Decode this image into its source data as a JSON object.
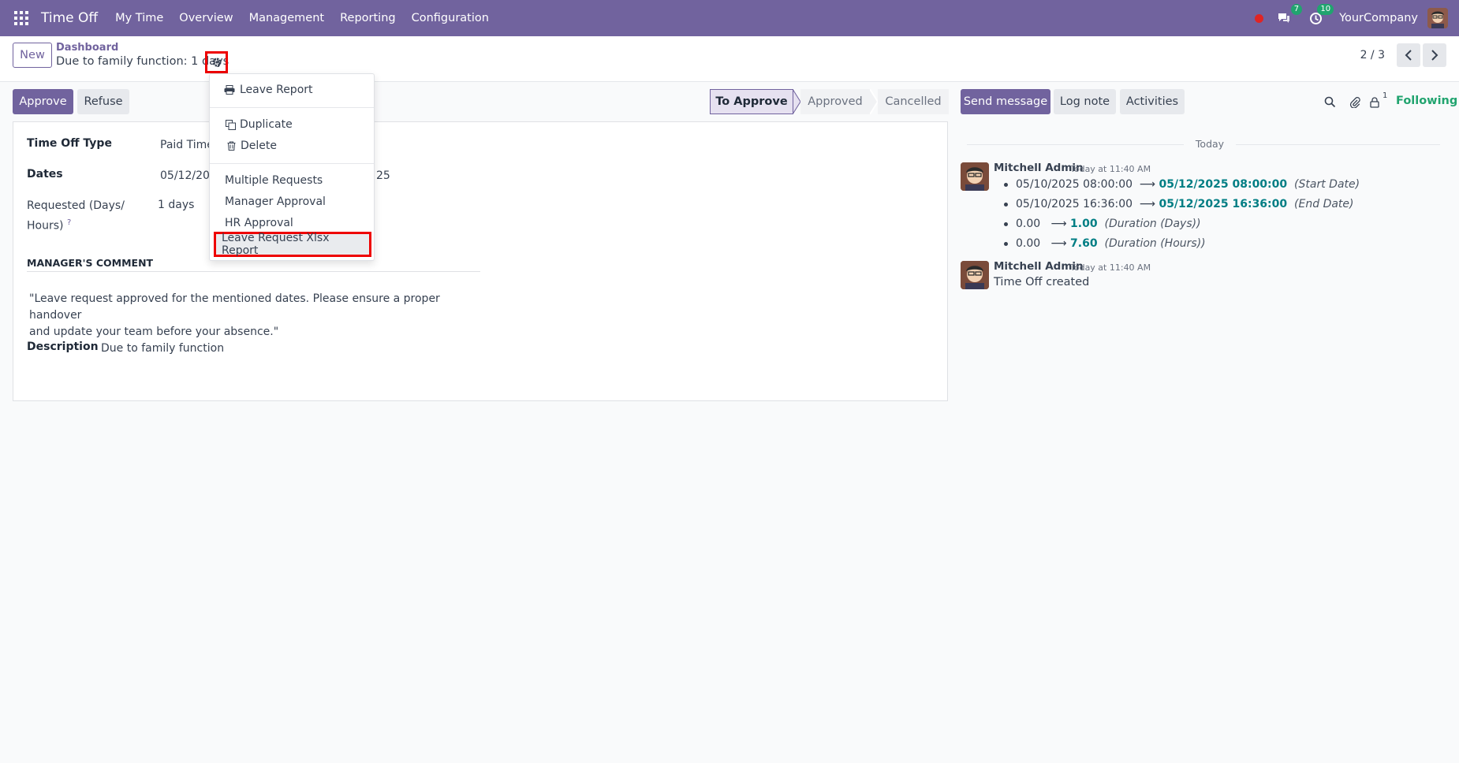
{
  "navbar": {
    "app_name": "Time Off",
    "menu": [
      "My Time",
      "Overview",
      "Management",
      "Reporting",
      "Configuration"
    ],
    "messages_badge": "7",
    "activities_badge": "10",
    "company": "YourCompany"
  },
  "control_panel": {
    "new_label": "New",
    "breadcrumb": "Dashboard",
    "record_title": "Due to family function: 1 days",
    "pager": "2 / 3"
  },
  "actions": {
    "approve": "Approve",
    "refuse": "Refuse"
  },
  "statusbar": [
    "To Approve",
    "Approved",
    "Cancelled"
  ],
  "form": {
    "time_off_type_label": "Time Off Type",
    "time_off_type_value": "Paid Time",
    "dates_label": "Dates",
    "dates_value_start": "05/12/20",
    "dates_value_end": "25",
    "requested_label_line1": "Requested (Days/",
    "requested_label_line2": "Hours)",
    "help_mark": "?",
    "requested_value": "1 days",
    "manager_comment_title": "MANAGER'S COMMENT",
    "manager_comment_line1": "\"Leave request approved for the mentioned dates. Please ensure a proper handover",
    "manager_comment_line2": "and update your team before your absence.\"",
    "description_label": "Description",
    "description_value": "Due to family function"
  },
  "action_menu": {
    "items": [
      "Leave Report",
      "Duplicate",
      "Delete",
      "Multiple Requests",
      "Manager Approval",
      "HR Approval",
      "Leave Request Xlsx Report"
    ]
  },
  "chatter": {
    "send_message": "Send message",
    "log_note": "Log note",
    "activities": "Activities",
    "follower_count": "1",
    "following": "Following",
    "day_label": "Today",
    "messages": [
      {
        "author": "Mitchell Admin",
        "date": "Today at 11:40 AM",
        "tracking": [
          {
            "old": "05/10/2025 08:00:00",
            "new": "05/12/2025 08:00:00",
            "field": "(Start Date)"
          },
          {
            "old": "05/10/2025 16:36:00",
            "new": "05/12/2025 16:36:00",
            "field": "(End Date)"
          },
          {
            "old": "0.00",
            "new": "1.00",
            "field": "(Duration (Days))"
          },
          {
            "old": "0.00",
            "new": "7.60",
            "field": "(Duration (Hours))"
          }
        ]
      },
      {
        "author": "Mitchell Admin",
        "date": "Today at 11:40 AM",
        "body": "Time Off created"
      }
    ]
  },
  "colors": {
    "brand": "#71639e",
    "success": "#21a46f",
    "tracking_value": "#017e84",
    "highlight_border": "#ee0000"
  }
}
